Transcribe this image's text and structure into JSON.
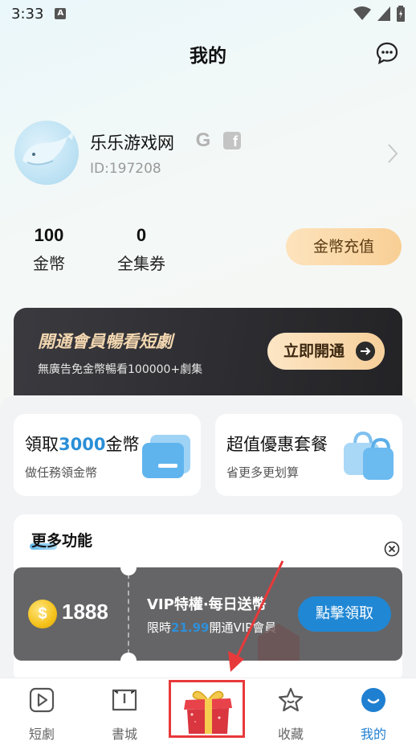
{
  "status_bar": {
    "time": "3:33",
    "notification_icon": "A"
  },
  "header": {
    "title": "我的",
    "message_icon": "chat-bubble-icon"
  },
  "profile": {
    "name": "乐乐游戏网",
    "id_text": "ID:197208",
    "google_icon": "G",
    "facebook_icon": "f"
  },
  "stats": [
    {
      "value": "100",
      "label": "金幣"
    },
    {
      "value": "0",
      "label": "全集券"
    }
  ],
  "recharge_button": "金幣充值",
  "vip_banner": {
    "title": "開通會員暢看短劇",
    "subtitle": "無廣告免金幣暢看100000+劇集",
    "button": "立即開通"
  },
  "task_cards": [
    {
      "title_prefix": "領取",
      "title_highlight": "3000",
      "title_suffix": "金幣",
      "subtitle": "做任務領金幣"
    },
    {
      "title_prefix": "超值優惠套餐",
      "title_highlight": "",
      "title_suffix": "",
      "subtitle": "省更多更划算"
    }
  ],
  "more_features": {
    "title": "更多功能"
  },
  "popup": {
    "coin_symbol": "$",
    "coin_amount": "1888",
    "title": "VIP特權·每日送幣",
    "sub_prefix": "限時",
    "sub_price": "21.99",
    "sub_suffix": "開通VIP會員",
    "button": "點擊領取"
  },
  "bottom_nav": [
    {
      "label": "短劇",
      "icon": "play-icon"
    },
    {
      "label": "書城",
      "icon": "book-icon"
    },
    {
      "label": "",
      "icon": "gift-icon"
    },
    {
      "label": "收藏",
      "icon": "star-icon"
    },
    {
      "label": "我的",
      "icon": "profile-icon"
    }
  ],
  "colors": {
    "accent": "#1f7fd0",
    "annotation": "#e8393a",
    "gold": "#f8cf95"
  }
}
